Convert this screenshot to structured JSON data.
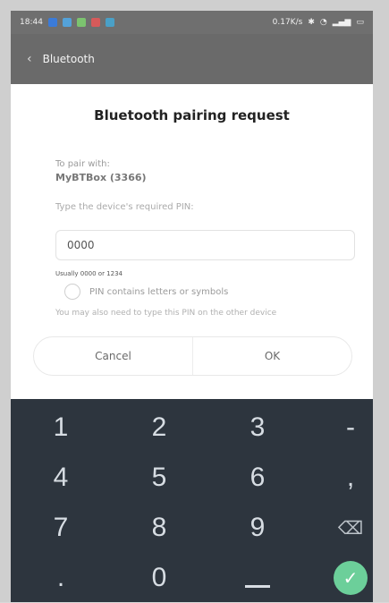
{
  "status_bar": {
    "time": "18:44",
    "right_text": "0.17K/s"
  },
  "appbar": {
    "title": "Bluetooth"
  },
  "dialog": {
    "title": "Bluetooth pairing request",
    "line1": "To pair with:",
    "device": "MyBTBox (3366)",
    "line3": "Type the device's required PIN:",
    "pin_value": "0000",
    "pin_hint": "Usually 0000 or 1234",
    "checkbox_label": "PIN contains letters or symbols",
    "info": "You may also need to type this PIN on the other device",
    "buttons": {
      "cancel": "Cancel",
      "ok": "OK"
    }
  },
  "keyboard": {
    "row1": [
      "1",
      "2",
      "3",
      "-"
    ],
    "row2": [
      "4",
      "5",
      "6",
      ","
    ],
    "row3": [
      "7",
      "8",
      "9",
      "backspace"
    ],
    "row4": [
      ".",
      "0",
      "_",
      "ok"
    ]
  },
  "colors": {
    "ok_accent": "#6ccf9a",
    "keyboard_bg": "#2d353e"
  }
}
